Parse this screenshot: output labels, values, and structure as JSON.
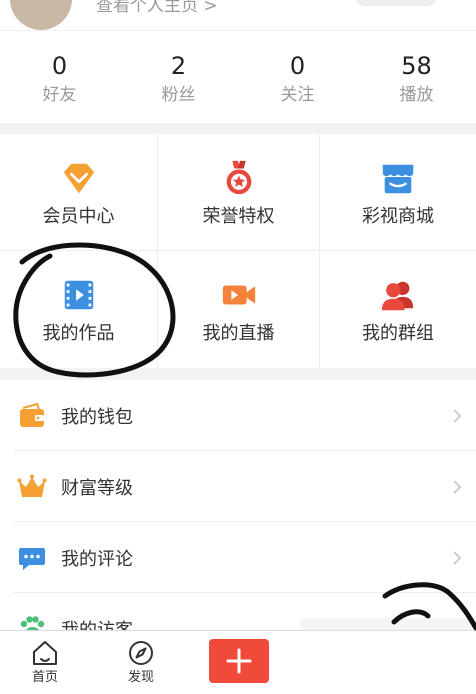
{
  "header": {
    "profile_link": "查看个人主页 >"
  },
  "stats": [
    {
      "value": "0",
      "label": "好友"
    },
    {
      "value": "2",
      "label": "粉丝"
    },
    {
      "value": "0",
      "label": "关注"
    },
    {
      "value": "58",
      "label": "播放"
    }
  ],
  "grid": [
    {
      "label": "会员中心",
      "icon": "vip-diamond-icon",
      "color": "#f5a033"
    },
    {
      "label": "荣誉特权",
      "icon": "medal-icon",
      "color": "#e9493d"
    },
    {
      "label": "彩视商城",
      "icon": "store-icon",
      "color": "#3d8fe0"
    },
    {
      "label": "我的作品",
      "icon": "video-film-icon",
      "color": "#3d8fe0"
    },
    {
      "label": "我的直播",
      "icon": "camera-icon",
      "color": "#f5823a"
    },
    {
      "label": "我的群组",
      "icon": "group-icon",
      "color": "#e9493d"
    }
  ],
  "menu": [
    {
      "label": "我的钱包",
      "icon": "wallet-icon",
      "color": "#f5a033"
    },
    {
      "label": "财富等级",
      "icon": "crown-icon",
      "color": "#f5a033"
    },
    {
      "label": "我的评论",
      "icon": "comment-icon",
      "color": "#3d8fe0"
    },
    {
      "label": "我的访客",
      "icon": "paw-icon",
      "color": "#4cbf7a"
    }
  ],
  "tabbar": {
    "home": "首页",
    "discover": "发现"
  },
  "colors": {
    "accent_red": "#f04a3a",
    "text_gray": "#9a9a9a",
    "background": "#f2f2f2"
  }
}
